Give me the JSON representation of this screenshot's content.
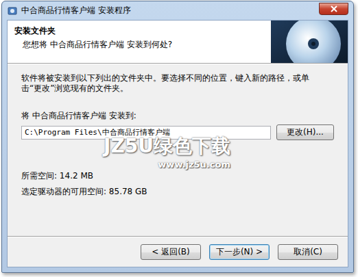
{
  "window": {
    "title": "中合商品行情客户端 安装程序"
  },
  "header": {
    "title": "安装文件夹",
    "subtitle": "您想将 中合商品行情客户端 安装到何处?"
  },
  "body": {
    "description": "软件将被安装到以下列出的文件夹中。要选择不同的位置，键入新的路径，或单击“更改”浏览现有的文件夹。",
    "path_label": "将 中合商品行情客户端 安装到:",
    "path_value": "C:\\Program Files\\中合商品行情客户端",
    "change_button": "更改(H)...",
    "required_space": "所需空间: 14.2 MB",
    "free_space": "选定驱动器的可用空间: 85.78 GB"
  },
  "buttons": [
    {
      "label": "< 返回(B)",
      "default": false
    },
    {
      "label": "下一步(N) >",
      "default": true
    },
    {
      "label": "取消(C)",
      "default": false
    }
  ],
  "watermark": {
    "brand": "JZ5U绿色下载",
    "url": "www.jz5u.com"
  }
}
